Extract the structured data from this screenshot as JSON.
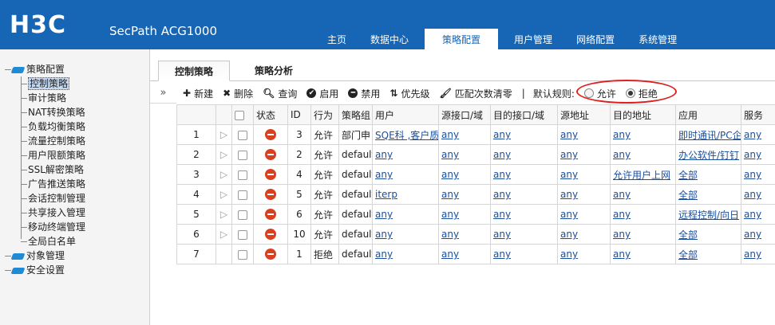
{
  "header": {
    "logo": "H3C",
    "product": "SecPath ACG1000",
    "nav": [
      "主页",
      "数据中心",
      "策略配置",
      "用户管理",
      "网络配置",
      "系统管理"
    ],
    "active_nav": 2
  },
  "tree": {
    "root1": "策略配置",
    "children": [
      "控制策略",
      "审计策略",
      "NAT转换策略",
      "负载均衡策略",
      "流量控制策略",
      "用户限额策略",
      "SSL解密策略",
      "广告推送策略",
      "会话控制管理",
      "共享接入管理",
      "移动终端管理",
      "全局白名单"
    ],
    "root2": "对象管理",
    "root3": "安全设置"
  },
  "tabs": {
    "active": "控制策略",
    "other": "策略分析"
  },
  "collapse": "»",
  "toolbar": {
    "new": "新建",
    "delete": "删除",
    "query": "查询",
    "enable": "启用",
    "disable": "禁用",
    "priority": "优先级",
    "clear": "匹配次数清零",
    "sep": "|",
    "default_rule": "默认规则:",
    "allow": "允许",
    "deny": "拒绝"
  },
  "table": {
    "headers": [
      "状态",
      "ID",
      "行为",
      "策略组",
      "用户",
      "源接口/域",
      "目的接口/域",
      "源地址",
      "目的地址",
      "应用",
      "服务"
    ],
    "rows": [
      {
        "no": "1",
        "id": "3",
        "action": "允许",
        "group": "部门申",
        "user": "SQE科 ,客户质",
        "src_if": "any",
        "dst_if": "any",
        "src_addr": "any",
        "dst_addr": "any",
        "app": "即时通讯/PC企",
        "svc": "any"
      },
      {
        "no": "2",
        "id": "2",
        "action": "允许",
        "group": "default",
        "user": "any",
        "src_if": "any",
        "dst_if": "any",
        "src_addr": "any",
        "dst_addr": "any",
        "app": "办公软件/钉钉",
        "svc": "any"
      },
      {
        "no": "3",
        "id": "4",
        "action": "允许",
        "group": "default",
        "user": "any",
        "src_if": "any",
        "dst_if": "any",
        "src_addr": "any",
        "dst_addr": "允许用户上网",
        "app": "全部",
        "svc": "any"
      },
      {
        "no": "4",
        "id": "5",
        "action": "允许",
        "group": "default",
        "user": "iterp",
        "src_if": "any",
        "dst_if": "any",
        "src_addr": "any",
        "dst_addr": "any",
        "app": "全部",
        "svc": "any"
      },
      {
        "no": "5",
        "id": "6",
        "action": "允许",
        "group": "default",
        "user": "any",
        "src_if": "any",
        "dst_if": "any",
        "src_addr": "any",
        "dst_addr": "any",
        "app": "远程控制/向日",
        "svc": "any"
      },
      {
        "no": "6",
        "id": "10",
        "action": "允许",
        "group": "default",
        "user": "any",
        "src_if": "any",
        "dst_if": "any",
        "src_addr": "any",
        "dst_addr": "any",
        "app": "全部",
        "svc": "any"
      },
      {
        "no": "7",
        "id": "1",
        "action": "拒绝",
        "group": "default",
        "user": "any",
        "src_if": "any",
        "dst_if": "any",
        "src_addr": "any",
        "dst_addr": "any",
        "app": "全部",
        "svc": "any"
      }
    ]
  }
}
